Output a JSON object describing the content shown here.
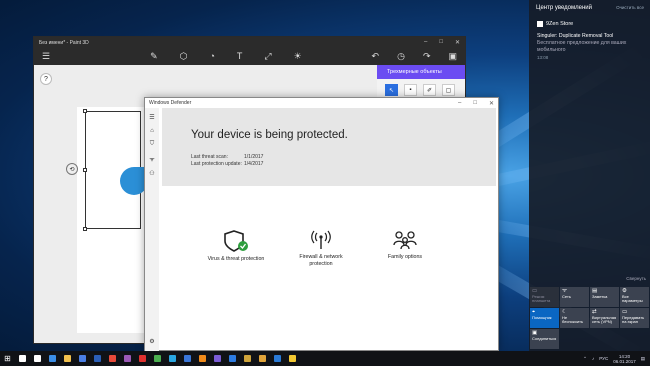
{
  "paint": {
    "title": "Без имени* - Paint 3D",
    "panel_title": "Трехмерные объекты",
    "help": "?"
  },
  "defender": {
    "title": "Windows Defender",
    "headline": "Your device is being protected.",
    "last_scan_label": "Last threat scan:",
    "last_scan_value": "1/1/2017",
    "last_update_label": "Last protection update:",
    "last_update_value": "1/4/2017",
    "tiles": [
      {
        "label": "Virus & threat protection",
        "icon": "shield-check-icon"
      },
      {
        "label": "Firewall & network protection",
        "icon": "antenna-icon"
      },
      {
        "label": "Family options",
        "icon": "family-icon"
      }
    ]
  },
  "action_center": {
    "title": "Центр уведомлений",
    "clear_all": "Очистить все",
    "app_name": "9Zen Store",
    "notif_title": "Singuler: Duplicate Removal Tool",
    "notif_body": "Бесплатное предложение для ваших мобильного",
    "notif_time": "13:08",
    "collapse": "Свернуть",
    "quick_actions": [
      {
        "label": "Режим планшета",
        "icon": "tablet-icon",
        "state": "dim"
      },
      {
        "label": "Сеть",
        "icon": "network-icon",
        "state": "off"
      },
      {
        "label": "Заметка",
        "icon": "note-icon",
        "state": "off"
      },
      {
        "label": "Все параметры",
        "icon": "gear-icon",
        "state": "off"
      },
      {
        "label": "Помощник",
        "icon": "location-icon",
        "state": "on"
      },
      {
        "label": "Не беспокоить",
        "icon": "moon-icon",
        "state": "off"
      },
      {
        "label": "Виртуальная сеть (VPN)",
        "icon": "vpn-icon",
        "state": "off"
      },
      {
        "label": "Передавать на экран",
        "icon": "project-icon",
        "state": "off"
      },
      {
        "label": "Соединиться",
        "icon": "connect-icon",
        "state": "off"
      }
    ]
  },
  "taskbar": {
    "lang": "РУС",
    "time": "14:20",
    "date": "06.01.2017",
    "apps": [
      {
        "icon": "search-icon",
        "color": "#ffffff"
      },
      {
        "icon": "task-view-icon",
        "color": "#ffffff"
      },
      {
        "icon": "edge-icon",
        "color": "#3b8ee6"
      },
      {
        "icon": "explorer-icon",
        "color": "#f2c14e"
      },
      {
        "icon": "store-icon",
        "color": "#4a7fe6"
      },
      {
        "icon": "word-icon",
        "color": "#2b5fb8"
      },
      {
        "icon": "media-icon",
        "color": "#e84a3a"
      },
      {
        "icon": "app-icon",
        "color": "#9b59b6"
      },
      {
        "icon": "opera-icon",
        "color": "#e0312f"
      },
      {
        "icon": "chrome-icon",
        "color": "#4caf50"
      },
      {
        "icon": "skype-icon",
        "color": "#2aa6e0"
      },
      {
        "icon": "mail-icon",
        "color": "#3a76d8"
      },
      {
        "icon": "vlc-icon",
        "color": "#f08a1a"
      },
      {
        "icon": "viber-icon",
        "color": "#7b5cd6"
      },
      {
        "icon": "photos-icon",
        "color": "#2d7be0"
      },
      {
        "icon": "maps-icon",
        "color": "#cfa43a"
      },
      {
        "icon": "paint3d-icon",
        "color": "#e0a43a"
      },
      {
        "icon": "defender-icon",
        "color": "#2a7ad6"
      },
      {
        "icon": "emoji-icon",
        "color": "#f2c832"
      }
    ]
  }
}
